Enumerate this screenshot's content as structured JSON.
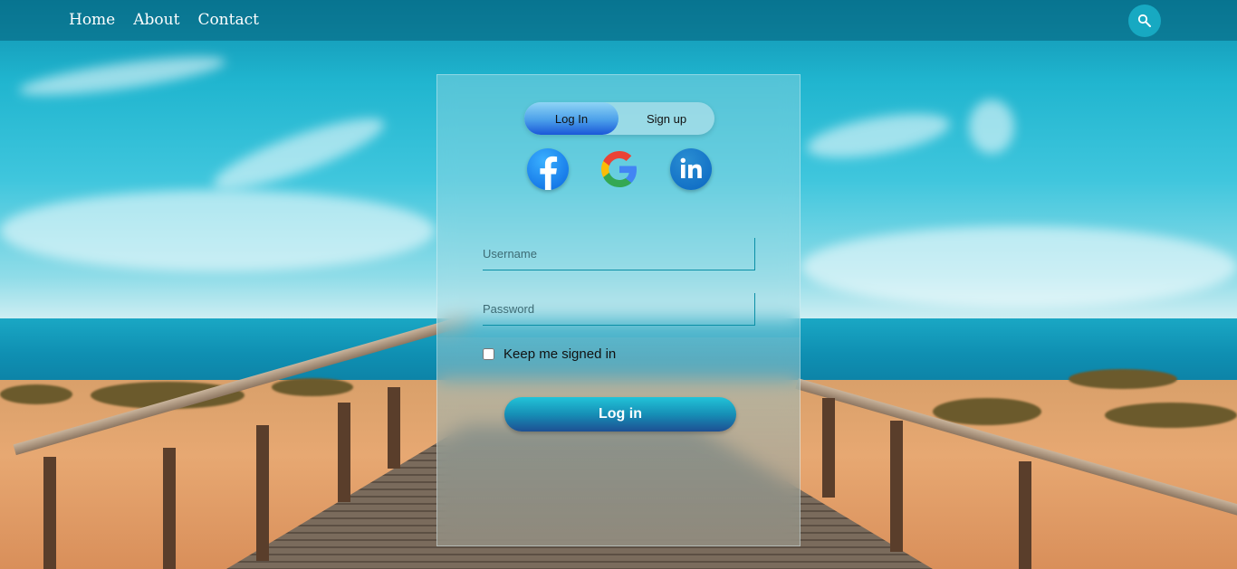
{
  "nav": {
    "items": [
      {
        "label": "Home"
      },
      {
        "label": "About"
      },
      {
        "label": "Contact"
      }
    ],
    "search_icon": "search-icon"
  },
  "card": {
    "toggle": {
      "login_label": "Log In",
      "signup_label": "Sign up",
      "active": "login"
    },
    "socials": [
      {
        "name": "facebook",
        "icon": "facebook-icon"
      },
      {
        "name": "google",
        "icon": "google-icon"
      },
      {
        "name": "linkedin",
        "icon": "linkedin-icon"
      }
    ],
    "username": {
      "placeholder": "Username",
      "value": ""
    },
    "password": {
      "placeholder": "Password",
      "value": ""
    },
    "keep_signed_in": {
      "label": "Keep me signed in",
      "checked": false
    },
    "submit_label": "Log in"
  },
  "colors": {
    "topbar": "#045f78",
    "search_button": "#17a9c2",
    "login_button_top": "#22c3d8",
    "login_button_bottom": "#1d4f93",
    "toggle_active": "#1a57d8"
  }
}
